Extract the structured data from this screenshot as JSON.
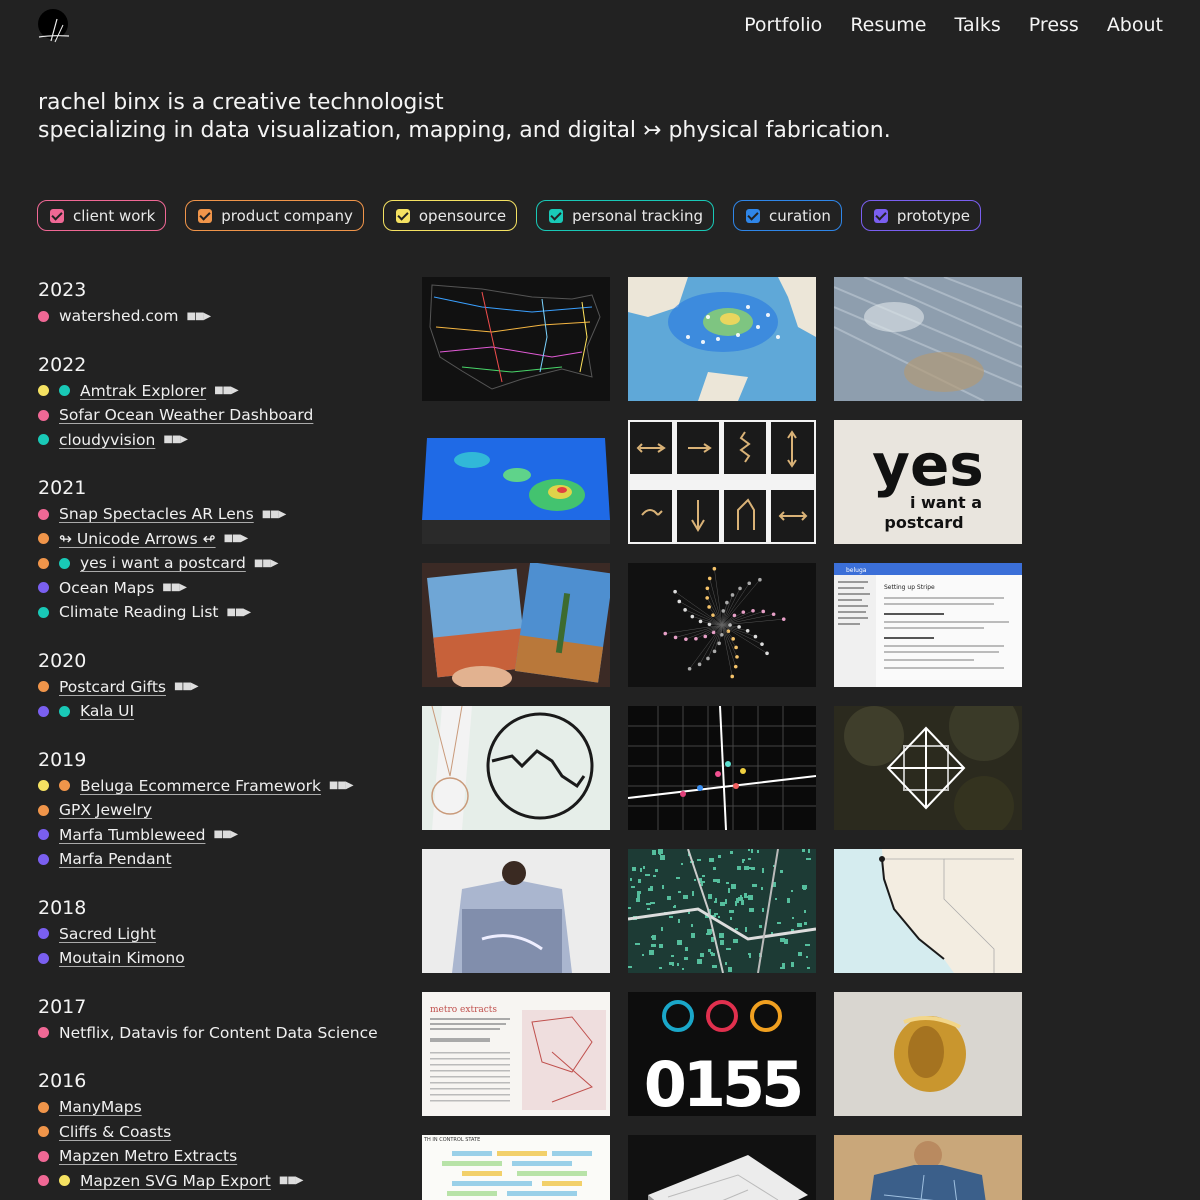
{
  "nav": [
    "Portfolio",
    "Resume",
    "Talks",
    "Press",
    "About"
  ],
  "intro": {
    "line1": "rachel binx is a creative technologist",
    "line2": "specializing in data visualization, mapping, and digital ↣ physical fabrication."
  },
  "colors": {
    "client": "#f06895",
    "product": "#f0954a",
    "opensource": "#f5e262",
    "tracking": "#19c9b7",
    "curation": "#2f86e8",
    "prototype": "#7a5ff0"
  },
  "filters": [
    {
      "label": "client work",
      "color": "#f06895"
    },
    {
      "label": "product company",
      "color": "#f0954a"
    },
    {
      "label": "opensource",
      "color": "#f5e262"
    },
    {
      "label": "personal tracking",
      "color": "#19c9b7"
    },
    {
      "label": "curation",
      "color": "#2f86e8"
    },
    {
      "label": "prototype",
      "color": "#7a5ff0"
    }
  ],
  "timeline": [
    {
      "year": "2023",
      "items": [
        {
          "label": "watershed.com",
          "dots": [
            "#f06895"
          ],
          "arrow": true,
          "link": false
        }
      ]
    },
    {
      "year": "2022",
      "items": [
        {
          "label": "Amtrak Explorer",
          "dots": [
            "#f5e262",
            "#19c9b7"
          ],
          "arrow": true,
          "link": true
        },
        {
          "label": "Sofar Ocean Weather Dashboard",
          "dots": [
            "#f06895"
          ],
          "arrow": false,
          "link": true
        },
        {
          "label": "cloudyvision",
          "dots": [
            "#19c9b7"
          ],
          "arrow": true,
          "link": true
        }
      ]
    },
    {
      "year": "2021",
      "items": [
        {
          "label": "Snap Spectacles AR Lens",
          "dots": [
            "#f06895"
          ],
          "arrow": true,
          "link": true
        },
        {
          "label": "↬ Unicode Arrows ↫",
          "dots": [
            "#f0954a"
          ],
          "arrow": true,
          "link": true
        },
        {
          "label": "yes i want a postcard",
          "dots": [
            "#f0954a",
            "#19c9b7"
          ],
          "arrow": true,
          "link": true
        },
        {
          "label": "Ocean Maps",
          "dots": [
            "#7a5ff0"
          ],
          "arrow": true,
          "link": false
        },
        {
          "label": "Climate Reading List",
          "dots": [
            "#19c9b7"
          ],
          "arrow": true,
          "link": false
        }
      ]
    },
    {
      "year": "2020",
      "items": [
        {
          "label": "Postcard Gifts",
          "dots": [
            "#f0954a"
          ],
          "arrow": true,
          "link": true
        },
        {
          "label": "Kala UI",
          "dots": [
            "#7a5ff0",
            "#19c9b7"
          ],
          "arrow": false,
          "link": true
        }
      ]
    },
    {
      "year": "2019",
      "items": [
        {
          "label": "Beluga Ecommerce Framework",
          "dots": [
            "#f5e262",
            "#f0954a"
          ],
          "arrow": true,
          "link": true
        },
        {
          "label": "GPX Jewelry",
          "dots": [
            "#f0954a"
          ],
          "arrow": false,
          "link": true
        },
        {
          "label": "Marfa Tumbleweed",
          "dots": [
            "#7a5ff0"
          ],
          "arrow": true,
          "link": true
        },
        {
          "label": "Marfa Pendant",
          "dots": [
            "#7a5ff0"
          ],
          "arrow": false,
          "link": true
        }
      ]
    },
    {
      "year": "2018",
      "items": [
        {
          "label": "Sacred Light",
          "dots": [
            "#7a5ff0"
          ],
          "arrow": false,
          "link": true
        },
        {
          "label": "Moutain Kimono",
          "dots": [
            "#7a5ff0"
          ],
          "arrow": false,
          "link": true
        }
      ]
    },
    {
      "year": "2017",
      "items": [
        {
          "label": "Netflix, Datavis for Content Data Science",
          "dots": [
            "#f06895"
          ],
          "arrow": false,
          "link": false
        }
      ]
    },
    {
      "year": "2016",
      "items": [
        {
          "label": "ManyMaps",
          "dots": [
            "#f0954a"
          ],
          "arrow": false,
          "link": true
        },
        {
          "label": "Cliffs & Coasts",
          "dots": [
            "#f0954a"
          ],
          "arrow": false,
          "link": true
        },
        {
          "label": "Mapzen Metro Extracts",
          "dots": [
            "#f06895"
          ],
          "arrow": false,
          "link": true
        },
        {
          "label": "Mapzen SVG Map Export",
          "dots": [
            "#f06895",
            "#f5e262"
          ],
          "arrow": true,
          "link": true
        }
      ]
    }
  ],
  "thumb_text": {
    "yes": "yes",
    "postcard_line1": "i want a",
    "postcard_line2": "postcard",
    "beluga_brand": "beluga",
    "beluga_heading": "Setting up Stripe",
    "metro_title": "metro extracts",
    "counter": "0155",
    "state_header": "TH IN CONTROL STATE"
  },
  "thumbnails": [
    {
      "name": "thumb-amtrak-map",
      "icon": "us-rail-map"
    },
    {
      "name": "thumb-ocean-weather",
      "icon": "ocean-heatmap"
    },
    {
      "name": "thumb-cloudyvision",
      "icon": "cloud-texture"
    },
    {
      "name": "thumb-hawaii-terrain",
      "icon": "terrain-3d"
    },
    {
      "name": "thumb-unicode-arrows",
      "icon": "arrow-pendants"
    },
    {
      "name": "thumb-yes-postcard",
      "icon": "postcard-logo"
    },
    {
      "name": "thumb-postcard-gifts",
      "icon": "postcard-photos"
    },
    {
      "name": "thumb-spiral-dots",
      "icon": "radial-dots"
    },
    {
      "name": "thumb-beluga-docs",
      "icon": "docs-page"
    },
    {
      "name": "thumb-gpx-pendant",
      "icon": "route-pendant"
    },
    {
      "name": "thumb-marfa-map",
      "icon": "street-grid"
    },
    {
      "name": "thumb-sacred-light",
      "icon": "light-geometry"
    },
    {
      "name": "thumb-kimono",
      "icon": "kimono-photo"
    },
    {
      "name": "thumb-city-buildings",
      "icon": "building-map"
    },
    {
      "name": "thumb-california-coast",
      "icon": "coastline-map"
    },
    {
      "name": "thumb-metro-extracts",
      "icon": "extracts-page"
    },
    {
      "name": "thumb-activity-counter",
      "icon": "activity-rings"
    },
    {
      "name": "thumb-gold-ring",
      "icon": "ring-photo"
    },
    {
      "name": "thumb-schedule-chart",
      "icon": "gantt-chart"
    },
    {
      "name": "thumb-map-book",
      "icon": "map-book"
    },
    {
      "name": "thumb-map-shirt",
      "icon": "map-shirt"
    }
  ]
}
